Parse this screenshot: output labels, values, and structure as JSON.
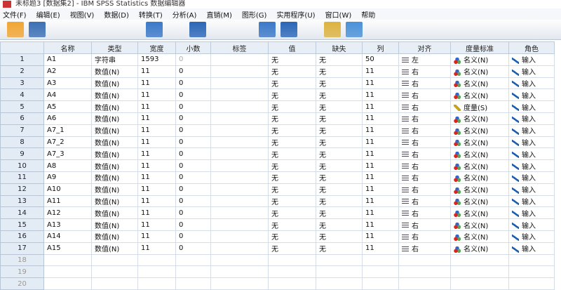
{
  "title": "未标题3 [数据集2] - IBM SPSS Statistics 数据编辑器",
  "menu": [
    "文件(F)",
    "编辑(E)",
    "视图(V)",
    "数据(D)",
    "转换(T)",
    "分析(A)",
    "直销(M)",
    "图形(G)",
    "实用程序(U)",
    "窗口(W)",
    "帮助"
  ],
  "toolbar": [
    "open-icon",
    "save-icon",
    "print-icon",
    "dialog-recall-icon",
    "undo-icon",
    "redo-icon",
    "goto-case-icon",
    "goto-variable-icon",
    "variables-icon",
    "find-icon",
    "insert-cases-icon",
    "insert-variable-icon",
    "split-file-icon",
    "weight-cases-icon",
    "select-cases-icon",
    "value-labels-icon",
    "use-sets-icon",
    "show-all-icon",
    "spelling-icon"
  ],
  "columns": [
    "名称",
    "类型",
    "宽度",
    "小数",
    "标签",
    "值",
    "缺失",
    "列",
    "对齐",
    "度量标准",
    "角色"
  ],
  "rows": [
    {
      "n": "1",
      "name": "A1",
      "type": "字符串",
      "width": "1593",
      "dec": "0",
      "label": "",
      "values": "无",
      "missing": "无",
      "cols": "50",
      "align": "左",
      "measure": "名义(N)",
      "role": "输入"
    },
    {
      "n": "2",
      "name": "A2",
      "type": "数值(N)",
      "width": "11",
      "dec": "0",
      "label": "",
      "values": "无",
      "missing": "无",
      "cols": "11",
      "align": "右",
      "measure": "名义(N)",
      "role": "输入"
    },
    {
      "n": "3",
      "name": "A3",
      "type": "数值(N)",
      "width": "11",
      "dec": "0",
      "label": "",
      "values": "无",
      "missing": "无",
      "cols": "11",
      "align": "右",
      "measure": "名义(N)",
      "role": "输入"
    },
    {
      "n": "4",
      "name": "A4",
      "type": "数值(N)",
      "width": "11",
      "dec": "0",
      "label": "",
      "values": "无",
      "missing": "无",
      "cols": "11",
      "align": "右",
      "measure": "名义(N)",
      "role": "输入"
    },
    {
      "n": "5",
      "name": "A5",
      "type": "数值(N)",
      "width": "11",
      "dec": "0",
      "label": "",
      "values": "无",
      "missing": "无",
      "cols": "11",
      "align": "右",
      "measure": "度量(S)",
      "role": "输入"
    },
    {
      "n": "6",
      "name": "A6",
      "type": "数值(N)",
      "width": "11",
      "dec": "0",
      "label": "",
      "values": "无",
      "missing": "无",
      "cols": "11",
      "align": "右",
      "measure": "名义(N)",
      "role": "输入"
    },
    {
      "n": "7",
      "name": "A7_1",
      "type": "数值(N)",
      "width": "11",
      "dec": "0",
      "label": "",
      "values": "无",
      "missing": "无",
      "cols": "11",
      "align": "右",
      "measure": "名义(N)",
      "role": "输入"
    },
    {
      "n": "8",
      "name": "A7_2",
      "type": "数值(N)",
      "width": "11",
      "dec": "0",
      "label": "",
      "values": "无",
      "missing": "无",
      "cols": "11",
      "align": "右",
      "measure": "名义(N)",
      "role": "输入"
    },
    {
      "n": "9",
      "name": "A7_3",
      "type": "数值(N)",
      "width": "11",
      "dec": "0",
      "label": "",
      "values": "无",
      "missing": "无",
      "cols": "11",
      "align": "右",
      "measure": "名义(N)",
      "role": "输入"
    },
    {
      "n": "10",
      "name": "A8",
      "type": "数值(N)",
      "width": "11",
      "dec": "0",
      "label": "",
      "values": "无",
      "missing": "无",
      "cols": "11",
      "align": "右",
      "measure": "名义(N)",
      "role": "输入"
    },
    {
      "n": "11",
      "name": "A9",
      "type": "数值(N)",
      "width": "11",
      "dec": "0",
      "label": "",
      "values": "无",
      "missing": "无",
      "cols": "11",
      "align": "右",
      "measure": "名义(N)",
      "role": "输入"
    },
    {
      "n": "12",
      "name": "A10",
      "type": "数值(N)",
      "width": "11",
      "dec": "0",
      "label": "",
      "values": "无",
      "missing": "无",
      "cols": "11",
      "align": "右",
      "measure": "名义(N)",
      "role": "输入"
    },
    {
      "n": "13",
      "name": "A11",
      "type": "数值(N)",
      "width": "11",
      "dec": "0",
      "label": "",
      "values": "无",
      "missing": "无",
      "cols": "11",
      "align": "右",
      "measure": "名义(N)",
      "role": "输入"
    },
    {
      "n": "14",
      "name": "A12",
      "type": "数值(N)",
      "width": "11",
      "dec": "0",
      "label": "",
      "values": "无",
      "missing": "无",
      "cols": "11",
      "align": "右",
      "measure": "名义(N)",
      "role": "输入"
    },
    {
      "n": "15",
      "name": "A13",
      "type": "数值(N)",
      "width": "11",
      "dec": "0",
      "label": "",
      "values": "无",
      "missing": "无",
      "cols": "11",
      "align": "右",
      "measure": "名义(N)",
      "role": "输入"
    },
    {
      "n": "16",
      "name": "A14",
      "type": "数值(N)",
      "width": "11",
      "dec": "0",
      "label": "",
      "values": "无",
      "missing": "无",
      "cols": "11",
      "align": "右",
      "measure": "名义(N)",
      "role": "输入"
    },
    {
      "n": "17",
      "name": "A15",
      "type": "数值(N)",
      "width": "11",
      "dec": "0",
      "label": "",
      "values": "无",
      "missing": "无",
      "cols": "11",
      "align": "右",
      "measure": "名义(N)",
      "role": "输入"
    }
  ],
  "empty_rows": [
    "18",
    "19",
    "20"
  ]
}
